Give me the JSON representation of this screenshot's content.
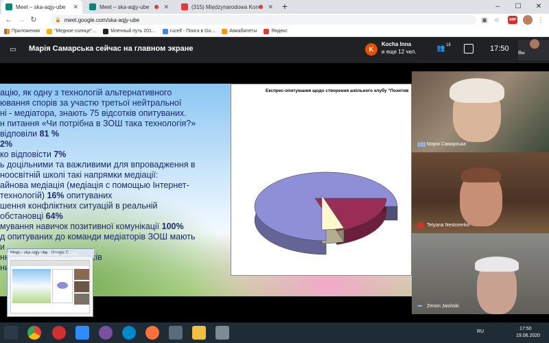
{
  "browser": {
    "tabs": [
      {
        "title": "Meet – ska-aqjy-ube",
        "recording": false,
        "active": true
      },
      {
        "title": "Meet – ska-aqjy-ube",
        "recording": true,
        "active": false
      },
      {
        "title": "(315) Międzynarodowa Konfere",
        "recording": true,
        "active": false
      }
    ],
    "new_tab": "+",
    "window_controls": {
      "minimize": "–",
      "maximize": "☐",
      "close": "✕"
    },
    "url": "meet.google.com/ska-aqjy-ube",
    "bookmarks": [
      "Приложения",
      "\"Медное солнце\"...",
      "Млечный путь 201...",
      "rucelf - Поиск в Go...",
      "Авиабилеты",
      "Яндекс"
    ],
    "adblock_label": "ABP"
  },
  "meet": {
    "presenter_text": "Марія Самарська сейчас на главном экране",
    "participant": {
      "initial": "K",
      "name": "Kocha Inna",
      "more": "и еще 12 чел."
    },
    "people_count": "18",
    "clock": "17:50",
    "self_label": "Вы"
  },
  "slide": {
    "lines": [
      {
        "text": "ацію, як одну з технологій альтернативного"
      },
      {
        "text": "ювання спорів за участю третьої нейтральної"
      },
      {
        "text": "ні - медіатора, знають 75 відсотків опитуваних."
      },
      {
        "text": "н питання «Чи потрібна в ЗОШ така технологія?»"
      },
      {
        "text": "відповіли ",
        "bold": "81 %"
      },
      {
        "text": "",
        "bold": "2%"
      },
      {
        "text": "ко відповісти ",
        "bold": "7%"
      },
      {
        "text": "ь доцільними та важливими для впровадження в"
      },
      {
        "text": "ноосвітній школі такі напрямки медіації:"
      },
      {
        "text": "айнова медіація (медіація с помощью Інтернет-"
      },
      {
        "text": "технологій) ",
        "bold": "16%",
        "after": " опитуваних"
      },
      {
        "text": "шення конфліктних ситуацій в реальній"
      },
      {
        "text": "обстановці ",
        "bold": "64%"
      },
      {
        "text": "мування навичок позитивної комунікації ",
        "bold": "100%"
      },
      {
        "text": "д опитуваних до команди медіаторів ЗОШ мають"
      },
      {
        "text": "и"
      },
      {
        "text": "ння з медіаційних сеансів"
      },
      {
        "text": "них сторін"
      }
    ],
    "chart_data": {
      "type": "pie",
      "title": "Експрес-опитування щодо створення шкільного клубу \"Позитив",
      "style": "3d-exploded",
      "slices": [
        {
          "value": 75,
          "color": "#8f8fd8"
        },
        {
          "value": 20,
          "color": "#9a2d55"
        },
        {
          "value": 5,
          "color": "#fff8cc"
        }
      ]
    }
  },
  "preview": {
    "title": "Meet – ska-aqjy-ube - Google C...",
    "caption": "Meet – ska-aqjy-ube - Google Chrome"
  },
  "tiles": [
    {
      "name": "Марія Самарська",
      "indicator": "speaking"
    },
    {
      "name": "Tetyana Nestorenko",
      "indicator": "muted"
    },
    {
      "name": "Zenon Jasiński",
      "indicator": "dots"
    }
  ],
  "taskbar": {
    "language": "RU",
    "time": "17:50",
    "date": "19.06.2020"
  }
}
